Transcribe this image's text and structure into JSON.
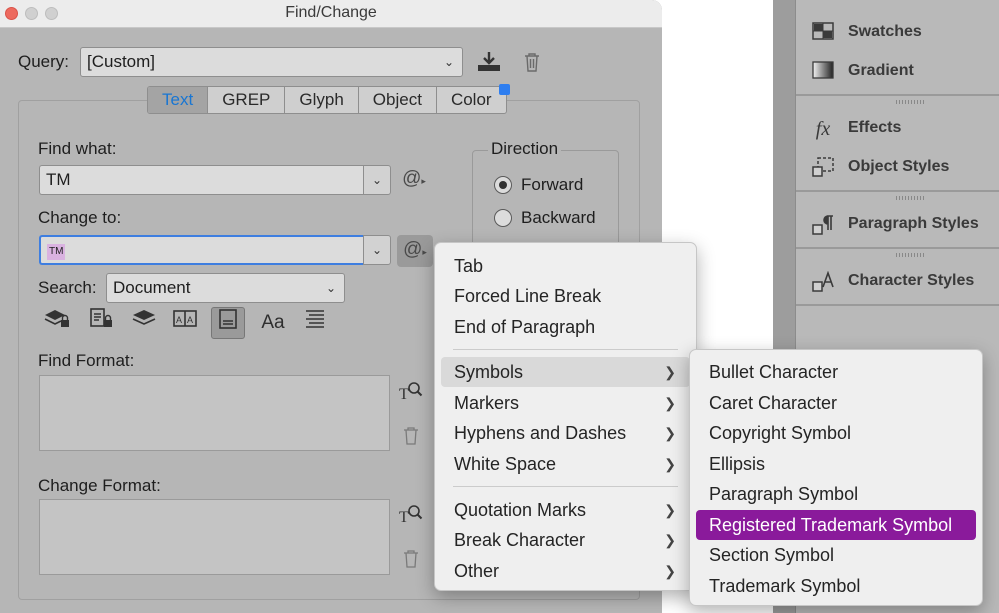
{
  "dialog": {
    "title": "Find/Change",
    "query_label": "Query:",
    "query_value": "[Custom]",
    "tabs": [
      "Text",
      "GREP",
      "Glyph",
      "Object",
      "Color"
    ],
    "active_tab": "Text",
    "find_label": "Find what:",
    "find_value": "TM",
    "change_label": "Change to:",
    "change_value": "TM",
    "special_char_glyph": "@",
    "direction_label": "Direction",
    "direction_options": [
      "Forward",
      "Backward"
    ],
    "direction_selected": "Forward",
    "search_label": "Search:",
    "search_value": "Document",
    "options_icons": [
      "lock-layers-icon",
      "locked-stories-icon",
      "hidden-layers-icon",
      "master-pages-icon",
      "footnotes-icon",
      "case-sensitive-icon",
      "whole-word-icon"
    ],
    "case_icon_text": "Aa",
    "find_format_label": "Find Format:",
    "change_format_label": "Change Format:"
  },
  "side_panels": {
    "items": [
      {
        "label": "Swatches",
        "icon": "swatches-icon"
      },
      {
        "label": "Gradient",
        "icon": "gradient-icon"
      },
      {
        "label": "Effects",
        "icon": "effects-icon",
        "glyph": "fx"
      },
      {
        "label": "Object Styles",
        "icon": "object-styles-icon"
      },
      {
        "label": "Paragraph Styles",
        "icon": "paragraph-styles-icon"
      },
      {
        "label": "Character Styles",
        "icon": "character-styles-icon"
      }
    ]
  },
  "special_menu": {
    "items": [
      "Tab",
      "Forced Line Break",
      "End of Paragraph",
      "Symbols",
      "Markers",
      "Hyphens and Dashes",
      "White Space",
      "Quotation Marks",
      "Break Character",
      "Other"
    ],
    "highlighted": "Symbols"
  },
  "symbols_menu": {
    "items": [
      "Bullet Character",
      "Caret Character",
      "Copyright Symbol",
      "Ellipsis",
      "Paragraph Symbol",
      "Registered Trademark Symbol",
      "Section Symbol",
      "Trademark Symbol"
    ],
    "selected": "Registered Trademark Symbol",
    "selected_color": "#8a1a9b"
  }
}
